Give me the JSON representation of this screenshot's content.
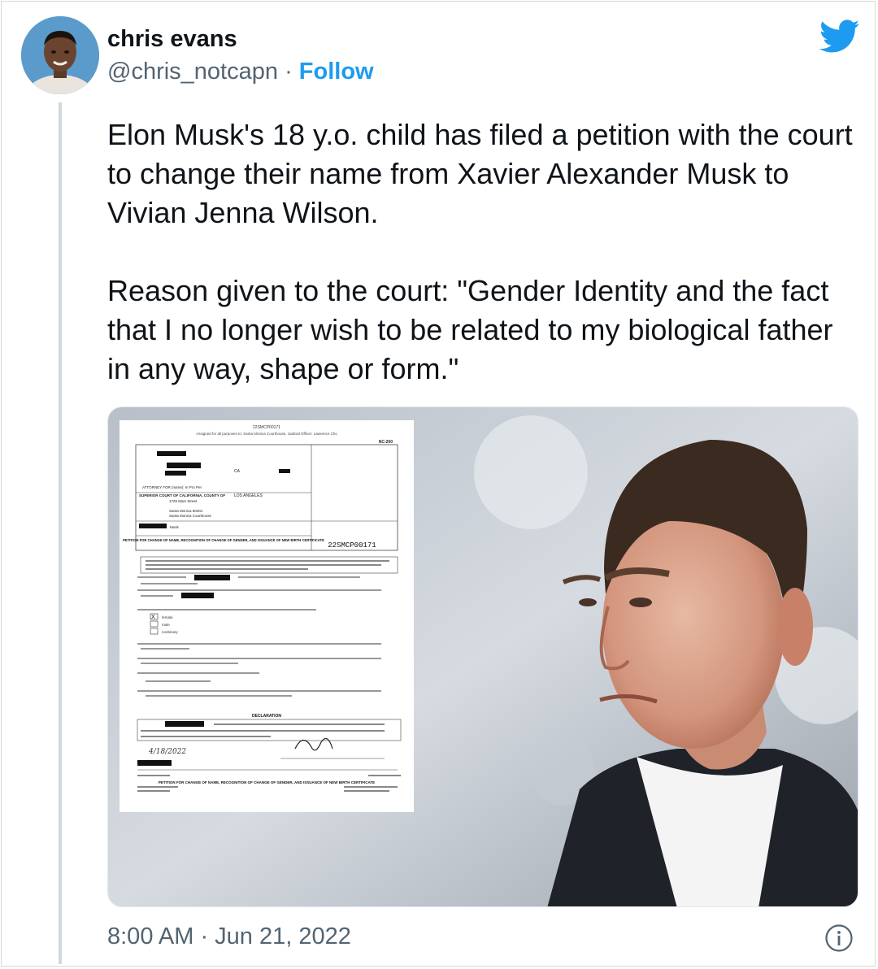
{
  "tweet": {
    "author_name": "chris evans",
    "handle": "@chris_notcapn",
    "separator": "·",
    "follow_label": "Follow",
    "text_paragraphs": [
      "Elon Musk's 18 y.o. child has filed a petition with the court to change their name from Xavier Alexander Musk to Vivian Jenna Wilson.",
      "Reason given to the court: \"Gender Identity and the fact that I no longer wish to be related to my biological father in any way, shape or form.\""
    ],
    "timestamp": "8:00 AM · Jun 21, 2022"
  },
  "document": {
    "case_ref_top": "22SMCP00171",
    "assigned_line": "Assigned for all purposes to: Santa Monica Courthouse, Judicial Officer: Lawrence Cho",
    "form_id": "NC-200",
    "attorney_line": "ATTORNEY FOR (name): In Pro Per",
    "court_title": "SUPERIOR COURT OF CALIFORNIA, COUNTY OF",
    "county": "LOS ANGELES",
    "street": "1725 Main Street",
    "city_zip": "Santa Monica 90401",
    "branch": "Santa Monica Courthouse",
    "state": "CA",
    "petition_title": "PETITION FOR CHANGE OF NAME, RECOGNITION OF CHANGE OF GENDER, AND ISSUANCE OF NEW BIRTH CERTIFICATE",
    "case_number": "22SMCP00171",
    "surname": "Musk",
    "declaration_label": "DECLARATION",
    "date_written": "4/18/2022",
    "option_female": "female",
    "option_male": "male",
    "option_nonbinary": "nonbinary"
  },
  "colors": {
    "text": "#0f1419",
    "muted": "#536471",
    "accent": "#1d9bf0",
    "thread_line": "#cfd9de"
  },
  "icons": {
    "platform": "twitter-bird-icon",
    "info": "info-icon"
  }
}
